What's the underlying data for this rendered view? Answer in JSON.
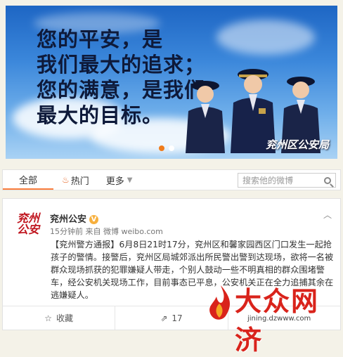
{
  "banner": {
    "slogan_lines": [
      "您的平安，是",
      "我们最大的追求；",
      "您的满意，是我们",
      "最大的目标。"
    ],
    "caption": "兖州区公安局",
    "slide_count": 2,
    "active_slide": 1
  },
  "tabs": {
    "all": "全部",
    "hot": "热门",
    "more": "更多",
    "search_placeholder": "搜索他的微博"
  },
  "post": {
    "avatar_text_line1": "兖州",
    "avatar_text_line2": "公安",
    "username": "兖州公安",
    "verified_mark": "V",
    "meta": "15分钟前 来自 微博 weibo.com",
    "content": "【兖州警方通报】6月8日21时17分，兖州区和馨家园西区门口发生一起抢孩子的警情。接警后，兖州区局城郊派出所民警出警到达现场，欲将一名被群众现场抓获的犯罪嫌疑人带走，个别人鼓动一些不明真相的群众围堵警车，经公安机关现场工作，目前事态已平息，公安机关正在全力追捕其余在逃嫌疑人。",
    "actions": {
      "favorite": "收藏",
      "repost_count": "17"
    }
  },
  "watermark": {
    "title": "大众网济",
    "url": "jining.dzwww.com"
  },
  "colors": {
    "accent_orange": "#fa7d3c",
    "brand_red": "#d9231b",
    "verified_yellow": "#f7b03e"
  }
}
